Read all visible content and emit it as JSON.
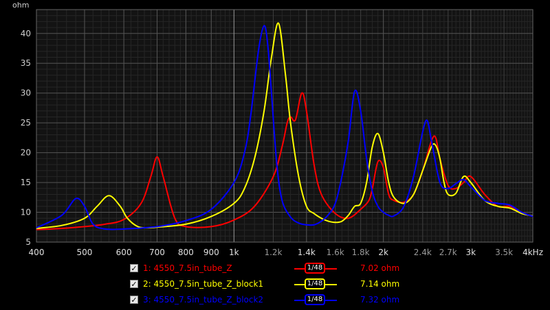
{
  "chart_data": {
    "type": "line",
    "ylabel": "ohm",
    "x_scale": "log",
    "xlim": [
      400,
      4000
    ],
    "ylim": [
      5,
      44
    ],
    "x_ticks": [
      {
        "v": 400,
        "label": "400",
        "major": true
      },
      {
        "v": 500,
        "label": "500",
        "major": true
      },
      {
        "v": 600,
        "label": "600",
        "major": true
      },
      {
        "v": 700,
        "label": "700",
        "major": true
      },
      {
        "v": 800,
        "label": "800",
        "major": true
      },
      {
        "v": 900,
        "label": "900",
        "major": true
      },
      {
        "v": 1000,
        "label": "1k",
        "major": true
      },
      {
        "v": 1200,
        "label": "1.2k",
        "major": false
      },
      {
        "v": 1400,
        "label": "1.4k",
        "major": true
      },
      {
        "v": 1600,
        "label": "1.6k",
        "major": false
      },
      {
        "v": 1800,
        "label": "1.8k",
        "major": false
      },
      {
        "v": 2000,
        "label": "2k",
        "major": true
      },
      {
        "v": 2400,
        "label": "2.4k",
        "major": false
      },
      {
        "v": 2700,
        "label": "2.7k",
        "major": false
      },
      {
        "v": 3000,
        "label": "3k",
        "major": true
      },
      {
        "v": 3500,
        "label": "3.5k",
        "major": false
      },
      {
        "v": 4000,
        "label": "4kHz",
        "major": true
      }
    ],
    "y_ticks": [
      5,
      10,
      15,
      20,
      25,
      30,
      35,
      40
    ],
    "series": [
      {
        "name": "1: 4550_7.5in_tube_Z",
        "color": "#ff0000",
        "smoothing": "1/48",
        "value": "7.02 ohm",
        "x": [
          400,
          450,
          500,
          550,
          600,
          650,
          680,
          700,
          720,
          760,
          800,
          900,
          1000,
          1100,
          1200,
          1250,
          1280,
          1300,
          1330,
          1370,
          1400,
          1450,
          1500,
          1600,
          1700,
          1800,
          1870,
          1900,
          1950,
          2000,
          2050,
          2100,
          2200,
          2300,
          2400,
          2500,
          2550,
          2600,
          2700,
          2800,
          2900,
          3000,
          3200,
          3400,
          3600,
          3800,
          4000
        ],
        "y": [
          7.1,
          7.3,
          7.6,
          8,
          8.8,
          11.5,
          16,
          19.3,
          16,
          9,
          7.6,
          7.6,
          8.7,
          11,
          16,
          21,
          25,
          26,
          25.5,
          30,
          27,
          18,
          13,
          9.8,
          9,
          10.5,
          12,
          14,
          18.5,
          17.5,
          13,
          12,
          11.7,
          13,
          17,
          22,
          22.5,
          19,
          14.5,
          14,
          15,
          16,
          13,
          11,
          11,
          10,
          9.3
        ]
      },
      {
        "name": "2: 4550_7.5in_tube_Z_block1",
        "color": "#ffff00",
        "smoothing": "1/48",
        "value": "7.14 ohm",
        "x": [
          400,
          450,
          500,
          530,
          560,
          590,
          610,
          640,
          670,
          700,
          800,
          900,
          1000,
          1050,
          1100,
          1150,
          1190,
          1230,
          1270,
          1300,
          1350,
          1400,
          1450,
          1500,
          1550,
          1600,
          1650,
          1700,
          1750,
          1800,
          1850,
          1900,
          1950,
          2000,
          2050,
          2100,
          2200,
          2300,
          2400,
          2500,
          2550,
          2600,
          2650,
          2700,
          2800,
          2900,
          3000,
          3200,
          3400,
          3600,
          3800,
          4000
        ],
        "y": [
          7.3,
          7.8,
          9,
          11,
          12.8,
          11,
          9,
          7.6,
          7.4,
          7.5,
          8,
          9.3,
          11.5,
          14,
          19,
          27,
          36,
          41.7,
          33,
          25,
          16,
          11,
          9.8,
          9,
          8.5,
          8.3,
          8.5,
          9.5,
          11,
          11.5,
          15,
          21,
          23.2,
          20,
          15,
          12.5,
          11.5,
          13,
          17,
          21,
          21.2,
          19,
          15,
          13,
          13.2,
          16,
          15,
          12,
          11,
          10.7,
          9.8,
          9.4
        ]
      },
      {
        "name": "3: 4550_7.5in_tube_Z_block2",
        "color": "#0000ff",
        "smoothing": "1/48",
        "value": "7.32 ohm",
        "x": [
          400,
          450,
          480,
          500,
          520,
          550,
          600,
          700,
          800,
          900,
          1000,
          1050,
          1080,
          1120,
          1150,
          1170,
          1190,
          1220,
          1250,
          1300,
          1350,
          1400,
          1450,
          1500,
          1550,
          1600,
          1650,
          1700,
          1750,
          1800,
          1850,
          1900,
          1950,
          2000,
          2050,
          2100,
          2200,
          2300,
          2400,
          2450,
          2500,
          2600,
          2700,
          2800,
          2900,
          3000,
          3200,
          3400,
          3600,
          3800,
          4000
        ],
        "y": [
          7.4,
          9.5,
          12.3,
          11,
          8,
          7.2,
          7.2,
          7.6,
          8.6,
          10.5,
          15,
          20,
          26,
          37,
          41.3,
          38,
          30,
          18,
          12,
          9.2,
          8.2,
          7.9,
          7.9,
          8.5,
          9.6,
          11.5,
          16,
          22,
          30.3,
          27,
          19,
          13.5,
          11,
          10,
          9.5,
          9.4,
          11,
          16,
          23.5,
          25.4,
          22,
          15,
          14,
          14.8,
          15.5,
          14.3,
          12,
          11.5,
          11.2,
          10,
          9.3
        ]
      }
    ]
  }
}
